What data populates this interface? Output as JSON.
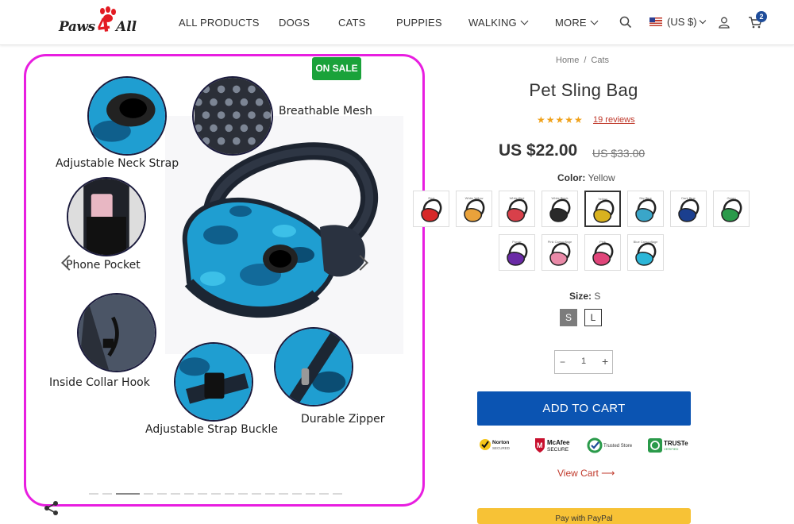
{
  "header": {
    "logo": "Paws4All",
    "nav": [
      {
        "label": "ALL PRODUCTS",
        "dropdown": false
      },
      {
        "label": "DOGS",
        "dropdown": false
      },
      {
        "label": "CATS",
        "dropdown": false
      },
      {
        "label": "PUPPIES",
        "dropdown": false
      },
      {
        "label": "WALKING",
        "dropdown": true
      },
      {
        "label": "MORE",
        "dropdown": true
      }
    ],
    "currency": "(US $)",
    "cart_count": "2"
  },
  "gallery": {
    "sale_badge": "ON SALE",
    "features": [
      {
        "label": "Adjustable Neck Strap"
      },
      {
        "label": "Breathable Mesh"
      },
      {
        "label": "Phone Pocket"
      },
      {
        "label": "Inside Collar Hook"
      },
      {
        "label": "Adjustable Strap Buckle"
      },
      {
        "label": "Durable Zipper"
      }
    ],
    "slide_count": 18,
    "active_slide": 3
  },
  "product": {
    "breadcrumb": [
      "Home",
      "Cats"
    ],
    "title": "Pet Sling Bag",
    "rating": 5,
    "stars": "★★★★★",
    "reviews": "19 reviews",
    "price": "US $22.00",
    "old_price": "US $33.00",
    "color_label": "Color:",
    "color_value": "Yellow",
    "swatches": [
      {
        "name": "Red",
        "color": "#d62828"
      },
      {
        "name": "White Yellow",
        "color": "#e9a23b"
      },
      {
        "name": "White Red",
        "color": "#d8404a"
      },
      {
        "name": "White Black",
        "color": "#2a2a2a"
      },
      {
        "name": "Yellow",
        "color": "#d9b21f"
      },
      {
        "name": "Sky Blue",
        "color": "#3aa6c9"
      },
      {
        "name": "Dark Blue",
        "color": "#1b3f8f"
      },
      {
        "name": "Green",
        "color": "#2a9a4a"
      },
      {
        "name": "Purple",
        "color": "#6a2aa6"
      },
      {
        "name": "Pink Camouflage",
        "color": "#e98aa8"
      },
      {
        "name": "Pink",
        "color": "#e0457a"
      },
      {
        "name": "Blue Camouflage",
        "color": "#2cb6d8"
      }
    ],
    "selected_swatch": 4,
    "size_label": "Size:",
    "size_value": "S",
    "sizes": [
      "S",
      "L"
    ],
    "quantity": "1",
    "qty_minus": "−",
    "qty_plus": "+",
    "add_to_cart": "ADD TO CART",
    "trust_badges": [
      "Norton SECURED",
      "McAfee SECURE",
      "Trusted Store",
      "TRUSTe VERIFIED"
    ],
    "view_cart": "View Cart ⟶",
    "paypal": "Pay with PayPal"
  },
  "colors": {
    "accent": "#0b54b2",
    "sale": "#1aa23a",
    "highlight_border": "#e81ee0",
    "star": "#f0a21b",
    "link": "#c0392b"
  }
}
